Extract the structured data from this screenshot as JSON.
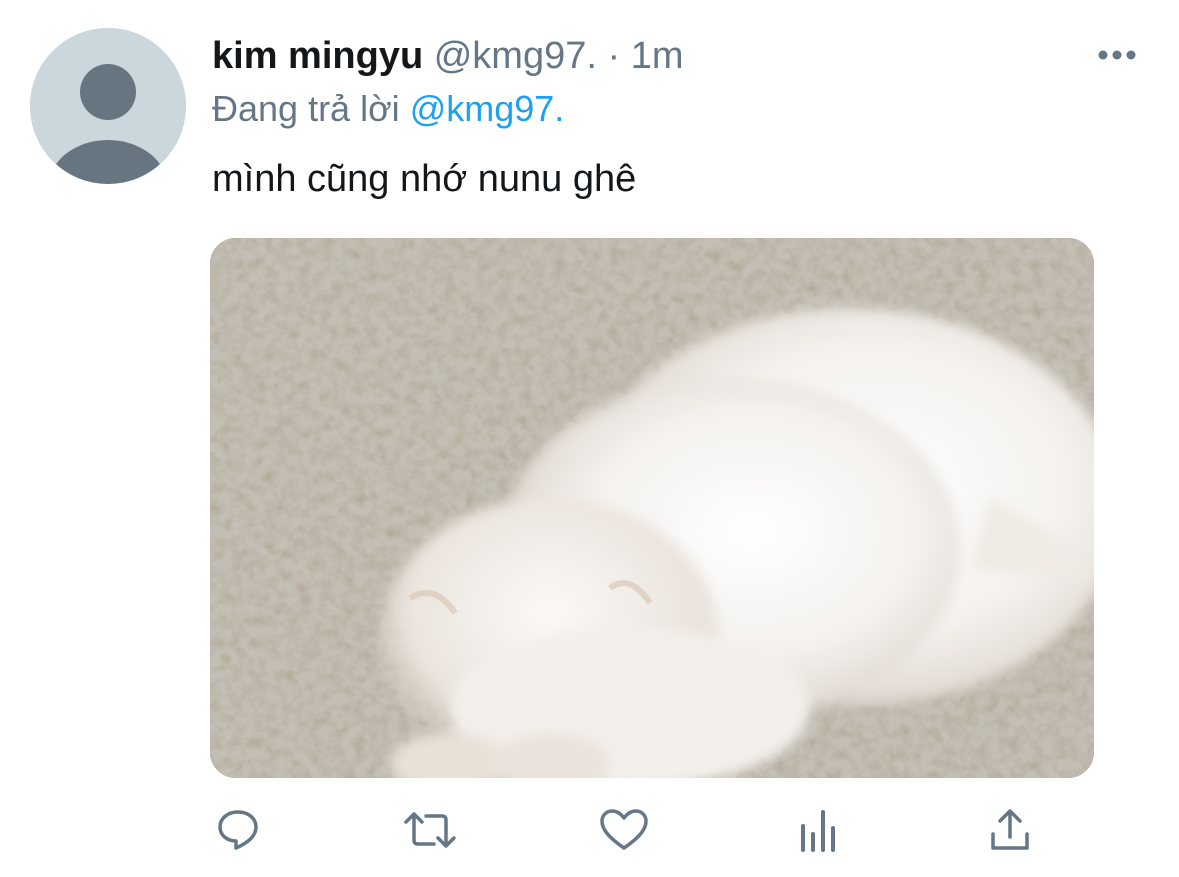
{
  "author": {
    "name": "kim mingyu",
    "handle": "@kmg97.",
    "separator": "·",
    "time": "1m"
  },
  "reply": {
    "prefix": "Đang trả lời",
    "mention": "@kmg97."
  },
  "tweet": {
    "text": "mình cũng nhớ nunu ghê"
  },
  "media": {
    "description_icon": "photo-white-fluffy-cat-on-carpet"
  },
  "actions": {
    "reply_icon": "comment-icon",
    "retweet_icon": "retweet-icon",
    "like_icon": "heart-icon",
    "analytics_icon": "analytics-icon",
    "share_icon": "share-icon"
  },
  "colors": {
    "text": "#14171a",
    "secondary": "#657786",
    "accent": "#1da1f2",
    "avatar_bg": "#ccd6dd",
    "avatar_fg": "#66757f"
  }
}
